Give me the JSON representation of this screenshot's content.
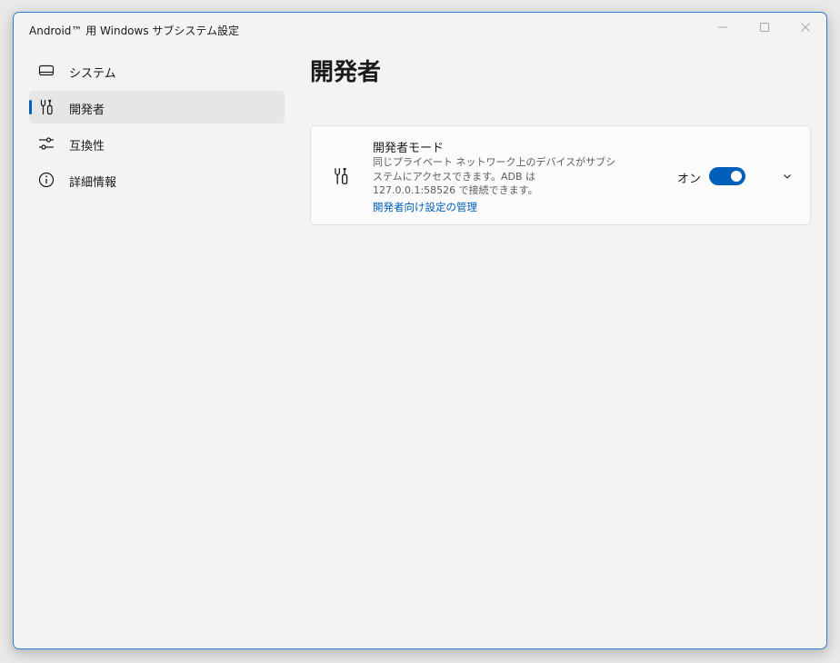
{
  "window": {
    "title": "Android™ 用 Windows サブシステム設定"
  },
  "caption_buttons": {
    "minimize_icon": "minimize-icon",
    "maximize_icon": "maximize-icon",
    "close_icon": "close-icon"
  },
  "sidebar": {
    "items": [
      {
        "label": "システム",
        "icon": "laptop-icon",
        "selected": false
      },
      {
        "label": "開発者",
        "icon": "tools-icon",
        "selected": true
      },
      {
        "label": "互換性",
        "icon": "sliders-icon",
        "selected": false
      },
      {
        "label": "詳細情報",
        "icon": "info-icon",
        "selected": false
      }
    ]
  },
  "main": {
    "page_title": "開発者",
    "developer_mode": {
      "icon": "tools-icon",
      "title": "開発者モード",
      "description": "同じプライベート ネットワーク上のデバイスがサブシステムにアクセスできます。ADB は 127.0.0.1:58526 で接続できます。",
      "link": "開発者向け設定の管理",
      "toggle_state_label": "オン",
      "toggle_on": true
    }
  },
  "colors": {
    "accent": "#005fb8",
    "window_border": "#2b7fd1",
    "background": "#f3f3f3"
  }
}
